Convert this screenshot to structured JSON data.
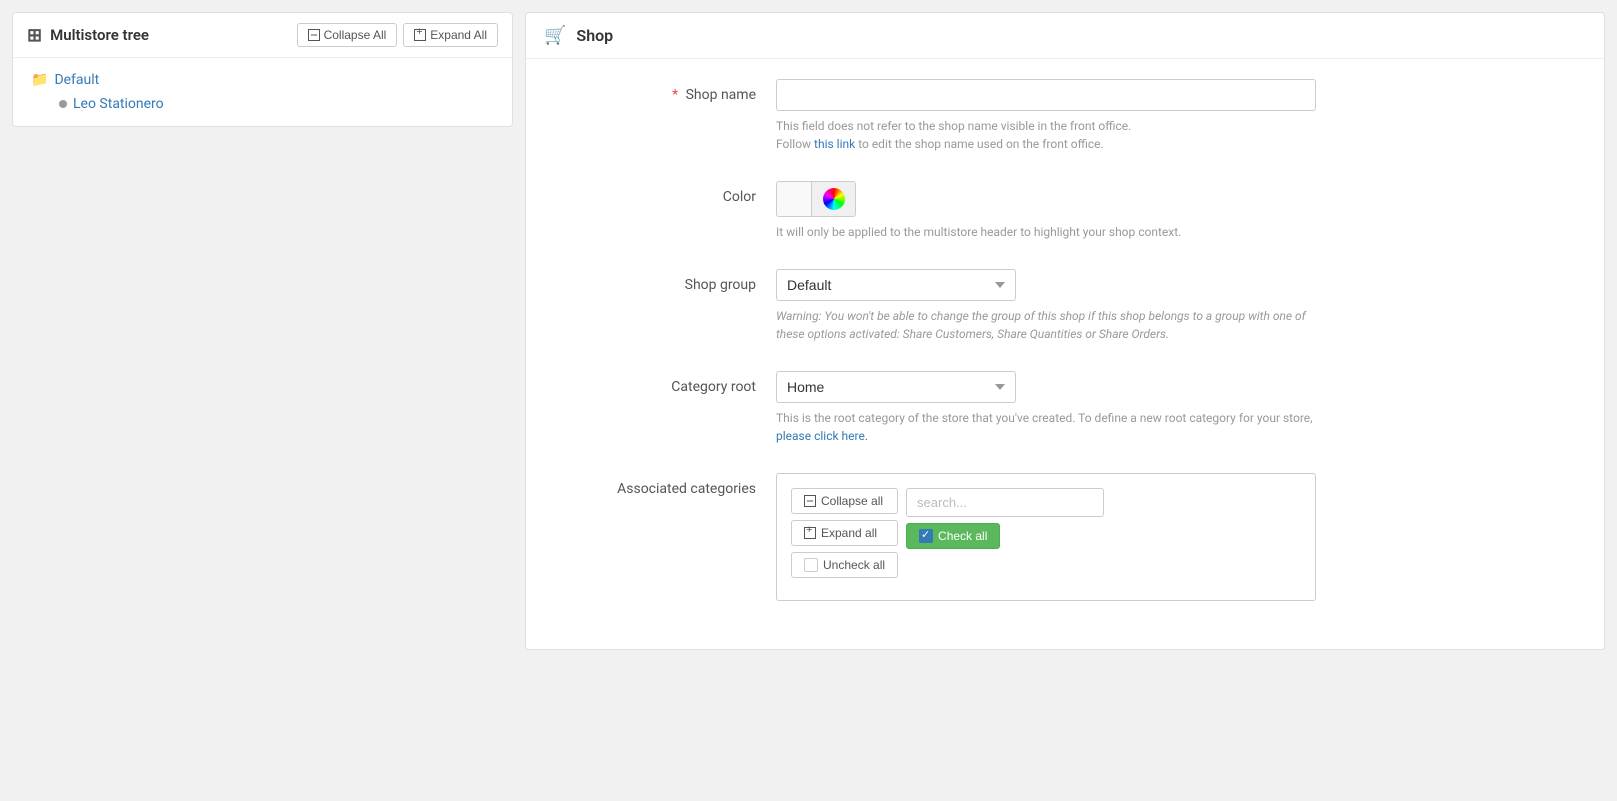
{
  "left": {
    "panel_title": "Multistore tree",
    "collapse_all_label": "Collapse All",
    "expand_all_label": "Expand All",
    "group": {
      "name": "Default"
    },
    "shop": {
      "name": "Leo Stationero"
    }
  },
  "right": {
    "section_title": "Shop",
    "fields": {
      "shop_name": {
        "label": "Shop name",
        "value": "",
        "placeholder": "",
        "help_text": "This field does not refer to the shop name visible in the front office.",
        "help_link_text": "this link",
        "help_link_suffix": "to edit the shop name used on the front office."
      },
      "color": {
        "label": "Color",
        "help_text": "It will only be applied to the multistore header to highlight your shop context."
      },
      "shop_group": {
        "label": "Shop group",
        "options": [
          "Default"
        ],
        "selected": "Default",
        "warning": "Warning: You won't be able to change the group of this shop if this shop belongs to a group with one of these options activated: Share Customers, Share Quantities or Share Orders."
      },
      "category_root": {
        "label": "Category root",
        "options": [
          "Home"
        ],
        "selected": "Home",
        "help_text": "This is the root category of the store that you've created. To define a new root category for your store,",
        "help_link_text": "please click here.",
        "help_link_full": "please click here."
      },
      "associated_categories": {
        "label": "Associated categories",
        "collapse_all_label": "Collapse all",
        "expand_all_label": "Expand all",
        "check_all_label": "Check all",
        "uncheck_all_label": "Uncheck all",
        "search_placeholder": "search..."
      }
    }
  }
}
